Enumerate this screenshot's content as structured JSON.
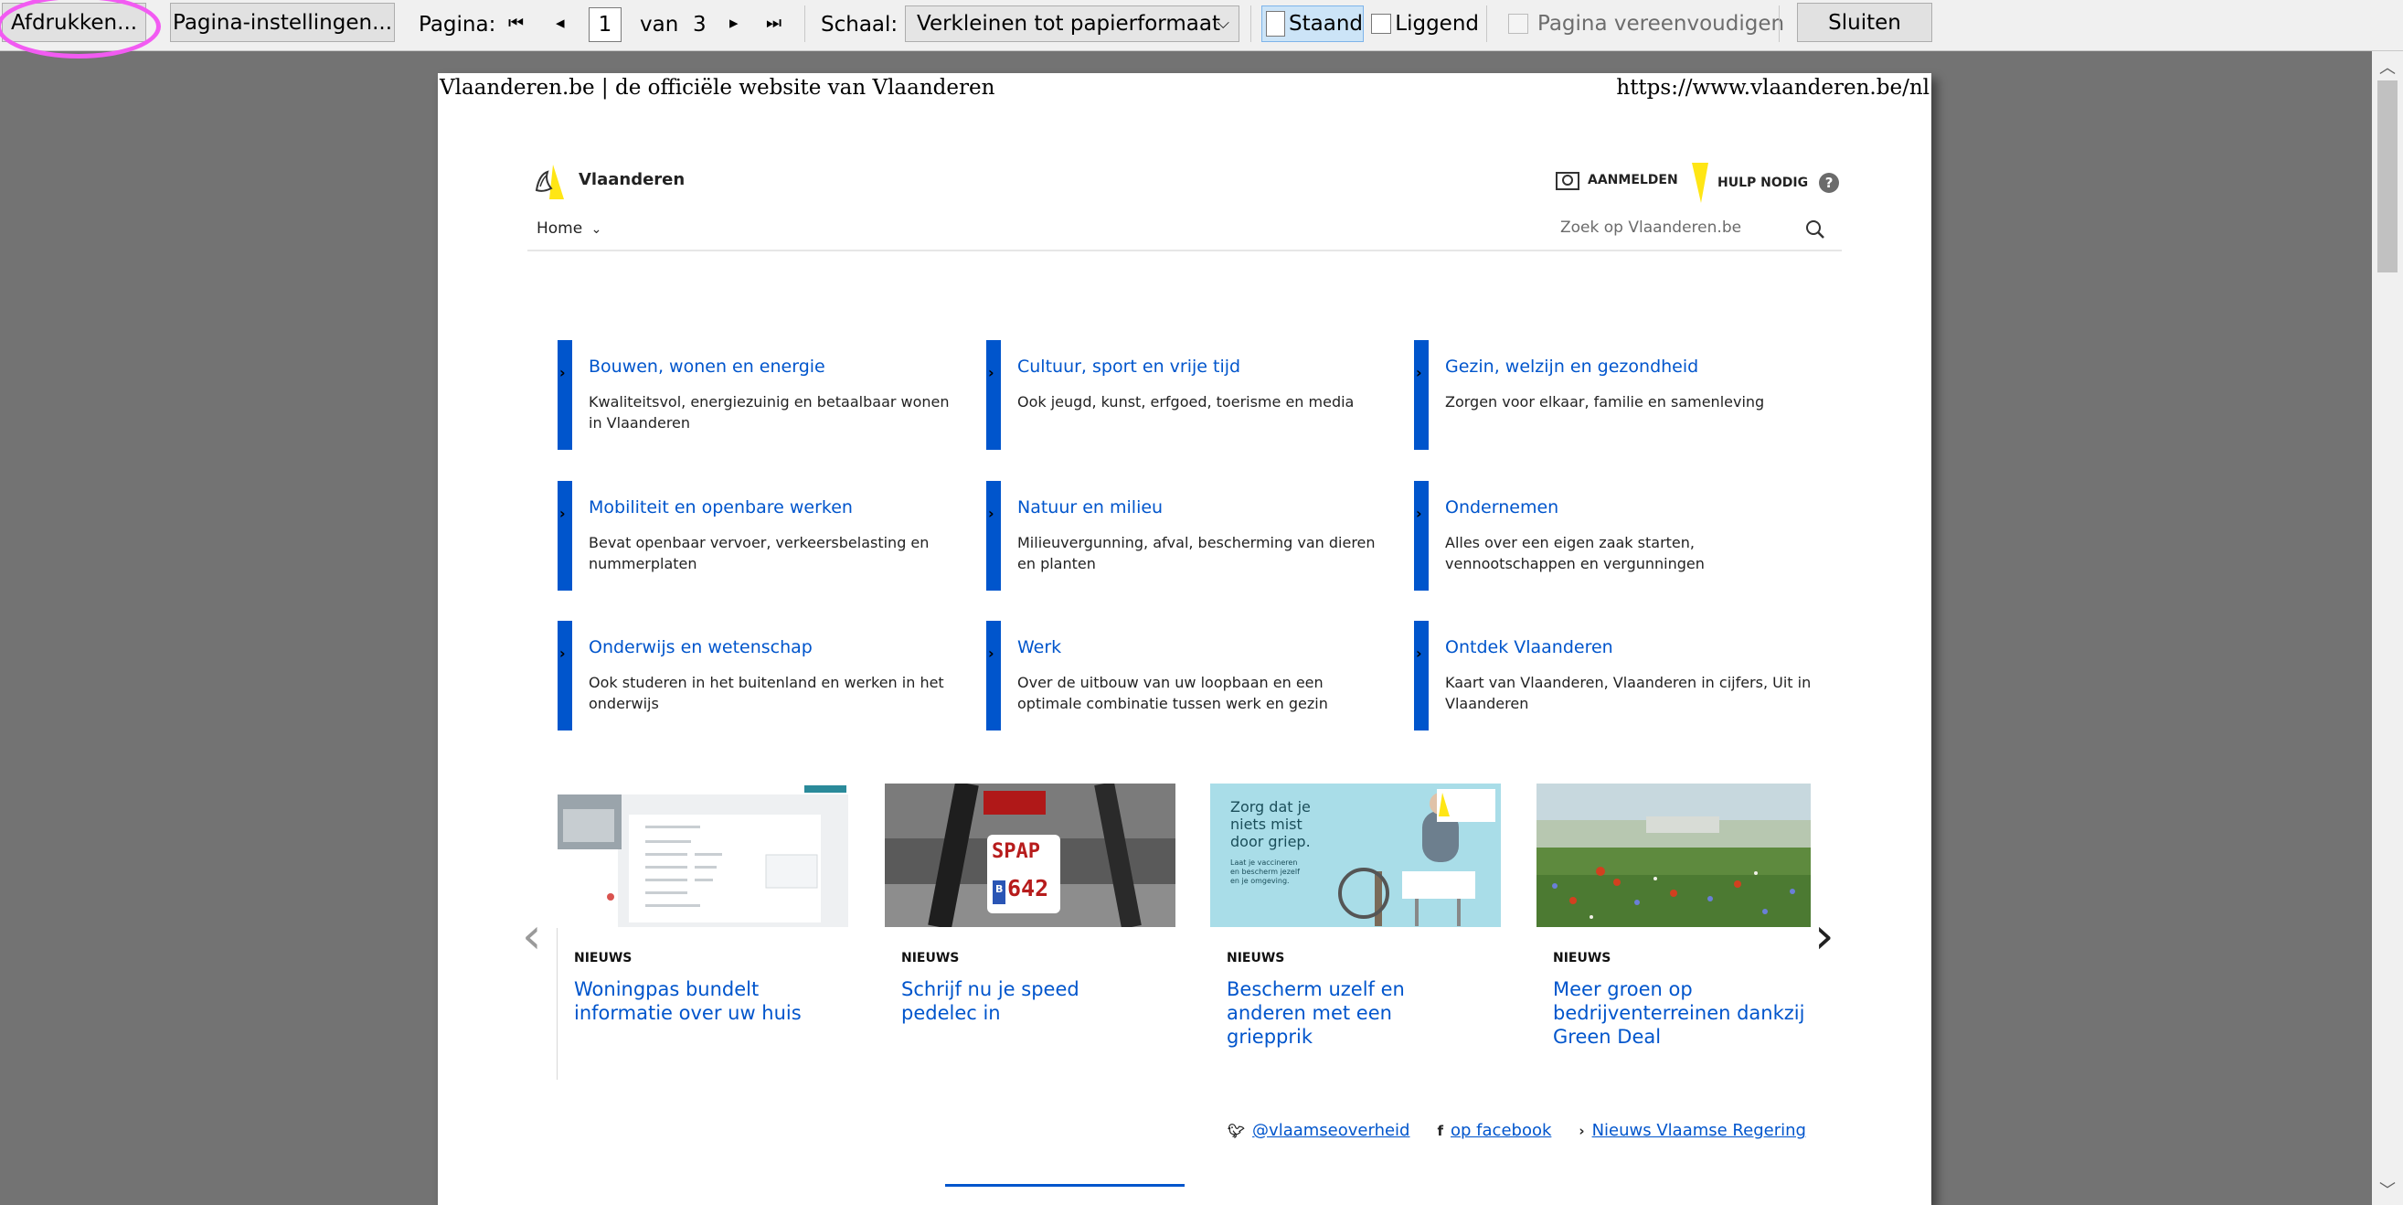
{
  "toolbar": {
    "print_label": "Afdrukken...",
    "page_setup_label": "Pagina-instellingen...",
    "page_label": "Pagina:",
    "first_icon": "⏮",
    "prev_icon": "◂",
    "current_page": "1",
    "of_label": "van",
    "total_pages": "3",
    "next_icon": "▸",
    "last_icon": "⏭",
    "scale_label": "Schaal:",
    "scale_value": "Verkleinen tot papierformaat",
    "portrait_label": "Staand",
    "landscape_label": "Liggend",
    "simplify_label": "Pagina vereenvoudigen",
    "close_label": "Sluiten"
  },
  "page": {
    "header_left": "Vlaanderen.be | de officiële website van Vlaanderen",
    "header_right": "https://www.vlaanderen.be/nl"
  },
  "site": {
    "brand": "Vlaanderen",
    "login": "AANMELDEN",
    "help": "HULP NODIG",
    "home": "Home",
    "search_placeholder": "Zoek op Vlaanderen.be"
  },
  "tiles": [
    {
      "title": "Bouwen, wonen en energie",
      "desc": "Kwaliteitsvol, energiezuinig en betaalbaar wonen in Vlaanderen"
    },
    {
      "title": "Cultuur, sport en vrije tijd",
      "desc": "Ook jeugd, kunst, erfgoed, toerisme en media"
    },
    {
      "title": "Gezin, welzijn en gezondheid",
      "desc": "Zorgen voor elkaar, familie en samenleving"
    },
    {
      "title": "Mobiliteit en openbare werken",
      "desc": "Bevat openbaar vervoer, verkeersbelasting en nummerplaten"
    },
    {
      "title": "Natuur en milieu",
      "desc": "Milieuvergunning, afval, bescherming van dieren en planten"
    },
    {
      "title": "Ondernemen",
      "desc": "Alles over een eigen zaak starten, vennootschappen en vergunningen"
    },
    {
      "title": "Onderwijs en wetenschap",
      "desc": "Ook studeren in het buitenland en werken in het onderwijs"
    },
    {
      "title": "Werk",
      "desc": "Over de uitbouw van uw loopbaan en een optimale combinatie tussen werk en gezin"
    },
    {
      "title": "Ontdek Vlaanderen",
      "desc": "Kaart van Vlaanderen, Vlaanderen in cijfers, Uit in Vlaanderen"
    }
  ],
  "news": [
    {
      "kicker": "NIEUWS",
      "title": "Woningpas bundelt informatie over uw huis"
    },
    {
      "kicker": "NIEUWS",
      "title": "Schrijf nu je speed pedelec in",
      "plate_top": "SPAP",
      "plate_bottom": "642",
      "plate_b": "B"
    },
    {
      "kicker": "NIEUWS",
      "title": "Bescherm uzelf en anderen met een griepprik",
      "img_text": "Zorg dat je niets mist door griep.",
      "img_sub": "Laat je vaccineren en bescherm jezelf en je omgeving."
    },
    {
      "kicker": "NIEUWS",
      "title": "Meer groen op bedrijventerreinen dankzij Green Deal"
    }
  ],
  "social": {
    "twitter": "@vlaamseoverheid",
    "facebook": "op facebook",
    "news": "Nieuws Vlaamse Regering"
  },
  "colors": {
    "link_blue": "#0055cc",
    "brand_yellow": "#ffe615",
    "highlight": "#f25bf2"
  }
}
